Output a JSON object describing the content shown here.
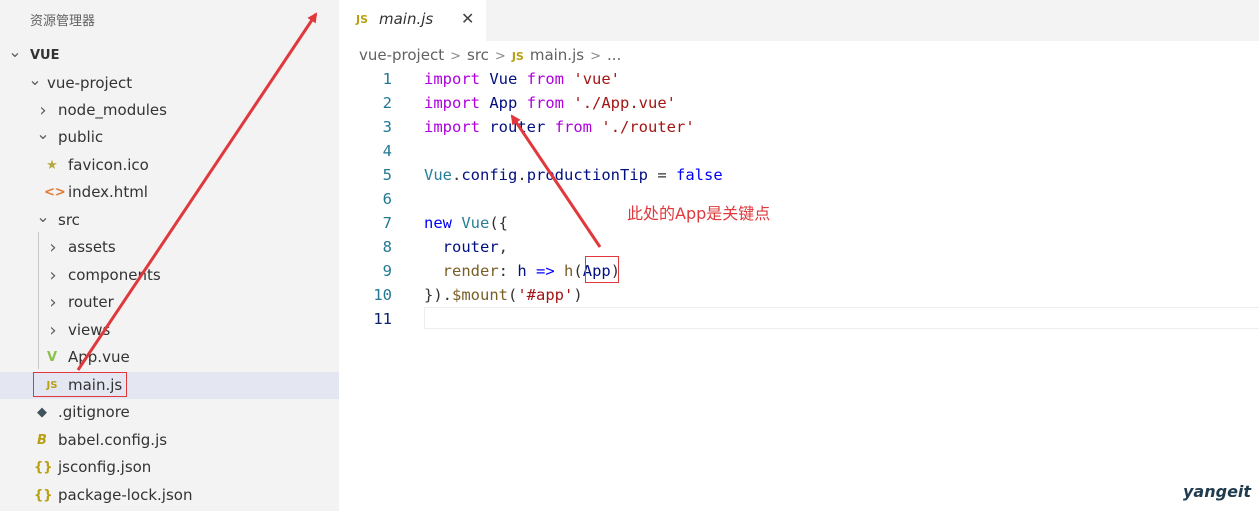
{
  "sidebar": {
    "title": "资源管理器",
    "tree": [
      {
        "label": "VUE",
        "indent": 0,
        "chevron": "v",
        "icon": "",
        "bold": true
      },
      {
        "label": "vue-project",
        "indent": 1,
        "chevron": "v",
        "icon": ""
      },
      {
        "label": "node_modules",
        "indent": 2,
        "chevron": ">",
        "icon": ""
      },
      {
        "label": "public",
        "indent": 2,
        "chevron": "v",
        "icon": ""
      },
      {
        "label": "favicon.ico",
        "indent": 3,
        "chevron": "",
        "icon": "star-icon"
      },
      {
        "label": "index.html",
        "indent": 3,
        "chevron": "",
        "icon": "html-icon"
      },
      {
        "label": "src",
        "indent": 2,
        "chevron": "v",
        "icon": ""
      },
      {
        "label": "assets",
        "indent": 3,
        "chevron": ">",
        "icon": ""
      },
      {
        "label": "components",
        "indent": 3,
        "chevron": ">",
        "icon": ""
      },
      {
        "label": "router",
        "indent": 3,
        "chevron": ">",
        "icon": ""
      },
      {
        "label": "views",
        "indent": 3,
        "chevron": ">",
        "icon": ""
      },
      {
        "label": "App.vue",
        "indent": 3,
        "chevron": "",
        "icon": "vue-icon"
      },
      {
        "label": "main.js",
        "indent": 3,
        "chevron": "",
        "icon": "js-icon",
        "selected": true
      },
      {
        "label": ".gitignore",
        "indent": 2,
        "chevron": "",
        "icon": "git-icon"
      },
      {
        "label": "babel.config.js",
        "indent": 2,
        "chevron": "",
        "icon": "babel-icon"
      },
      {
        "label": "jsconfig.json",
        "indent": 2,
        "chevron": "",
        "icon": "json-icon"
      },
      {
        "label": "package-lock.json",
        "indent": 2,
        "chevron": "",
        "icon": "json-icon"
      }
    ]
  },
  "tab": {
    "icon_text": "JS",
    "label": "main.js",
    "close": "✕"
  },
  "breadcrumb": {
    "items": [
      "vue-project",
      "src",
      "main.js",
      "..."
    ],
    "js_badge": "JS"
  },
  "code": {
    "lines": [
      {
        "n": "1",
        "tokens": [
          [
            "k",
            "import"
          ],
          [
            "p",
            " "
          ],
          [
            "v",
            "Vue"
          ],
          [
            "p",
            " "
          ],
          [
            "k",
            "from"
          ],
          [
            "p",
            " "
          ],
          [
            "s",
            "'vue'"
          ]
        ]
      },
      {
        "n": "2",
        "tokens": [
          [
            "k",
            "import"
          ],
          [
            "p",
            " "
          ],
          [
            "v",
            "App"
          ],
          [
            "p",
            " "
          ],
          [
            "k",
            "from"
          ],
          [
            "p",
            " "
          ],
          [
            "s",
            "'./App.vue'"
          ]
        ]
      },
      {
        "n": "3",
        "tokens": [
          [
            "k",
            "import"
          ],
          [
            "p",
            " "
          ],
          [
            "v",
            "router"
          ],
          [
            "p",
            " "
          ],
          [
            "k",
            "from"
          ],
          [
            "p",
            " "
          ],
          [
            "s",
            "'./router'"
          ]
        ]
      },
      {
        "n": "4",
        "tokens": []
      },
      {
        "n": "5",
        "tokens": [
          [
            "t",
            "Vue"
          ],
          [
            "p",
            "."
          ],
          [
            "v",
            "config"
          ],
          [
            "p",
            "."
          ],
          [
            "v",
            "productionTip"
          ],
          [
            "p",
            " = "
          ],
          [
            "b",
            "false"
          ]
        ]
      },
      {
        "n": "6",
        "tokens": []
      },
      {
        "n": "7",
        "tokens": [
          [
            "b",
            "new"
          ],
          [
            "p",
            " "
          ],
          [
            "t",
            "Vue"
          ],
          [
            "p",
            "({"
          ]
        ]
      },
      {
        "n": "8",
        "tokens": [
          [
            "p",
            "  "
          ],
          [
            "v",
            "router"
          ],
          [
            "p",
            ","
          ]
        ]
      },
      {
        "n": "9",
        "tokens": [
          [
            "p",
            "  "
          ],
          [
            "f",
            "render"
          ],
          [
            "p",
            ": "
          ],
          [
            "v",
            "h"
          ],
          [
            "p",
            " "
          ],
          [
            "b",
            "=>"
          ],
          [
            "p",
            " "
          ],
          [
            "f",
            "h"
          ],
          [
            "p",
            "("
          ],
          [
            "v",
            "App"
          ],
          [
            "p",
            ")"
          ]
        ]
      },
      {
        "n": "10",
        "tokens": [
          [
            "p",
            "})."
          ],
          [
            "f",
            "$mount"
          ],
          [
            "p",
            "("
          ],
          [
            "s",
            "'#app'"
          ],
          [
            "p",
            ")"
          ]
        ]
      },
      {
        "n": "11",
        "tokens": []
      }
    ]
  },
  "annotation": {
    "note": "此处的App是关键点"
  },
  "watermark": "yangeit",
  "colors": {
    "annotation_red": "#e0383c",
    "keyword": "#af00db",
    "string": "#a31515"
  }
}
